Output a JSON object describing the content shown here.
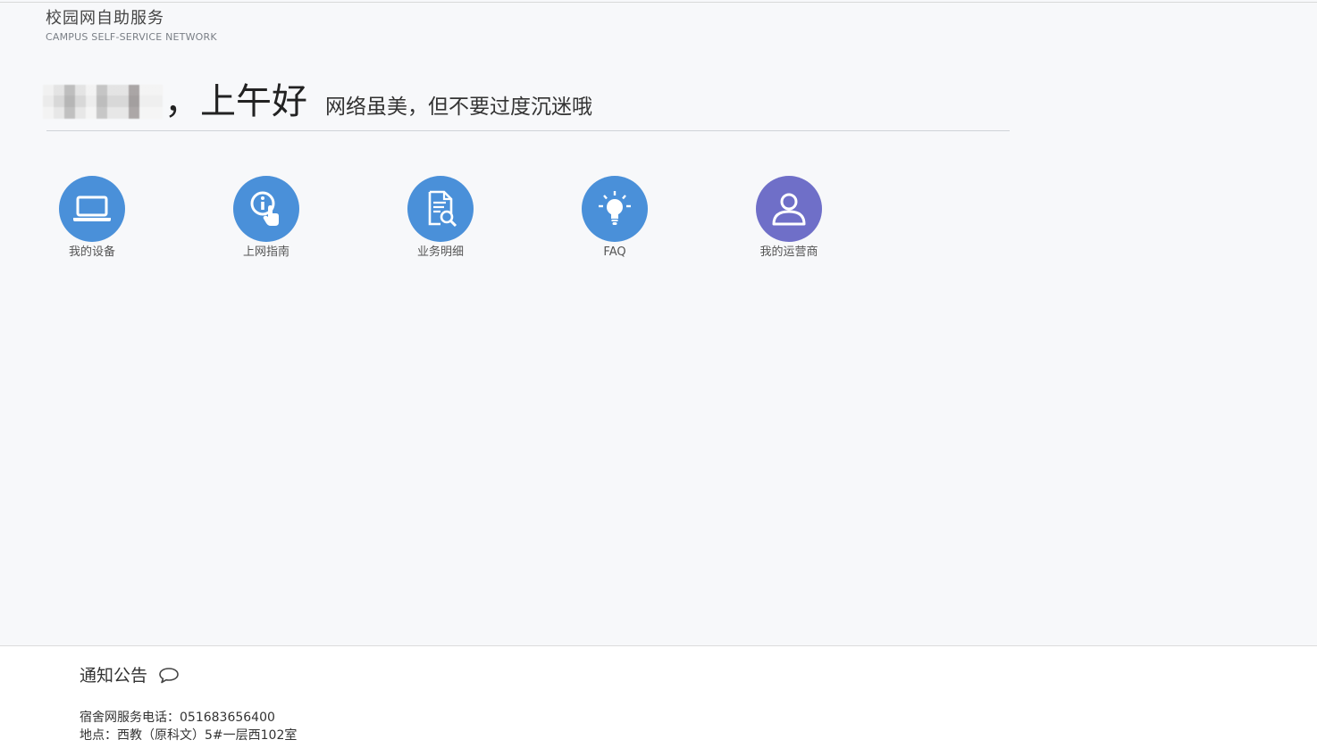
{
  "header": {
    "title": "校园网自助服务",
    "subtitle": "CAMPUS  SELF-SERVICE NETWORK"
  },
  "greeting": {
    "username_blurred": true,
    "text": "，上午好",
    "slogan": "网络虽美，但不要过度沉迷哦"
  },
  "shortcuts": [
    {
      "label": "我的设备",
      "icon": "laptop-icon",
      "color": "#4a90d9"
    },
    {
      "label": "上网指南",
      "icon": "info-pointer-icon",
      "color": "#4a90d9"
    },
    {
      "label": "业务明细",
      "icon": "document-search-icon",
      "color": "#4a90d9"
    },
    {
      "label": "FAQ",
      "icon": "lightbulb-icon",
      "color": "#4a90d9"
    },
    {
      "label": "我的运营商",
      "icon": "user-icon",
      "color": "#6f6fc8"
    }
  ],
  "footer": {
    "notice_title": "通知公告",
    "notice_icon": "speech-bubble-icon",
    "phone_line": "宿舍网服务电话：051683656400",
    "address_line": "地点：西教（原科文）5#一层西102室"
  }
}
